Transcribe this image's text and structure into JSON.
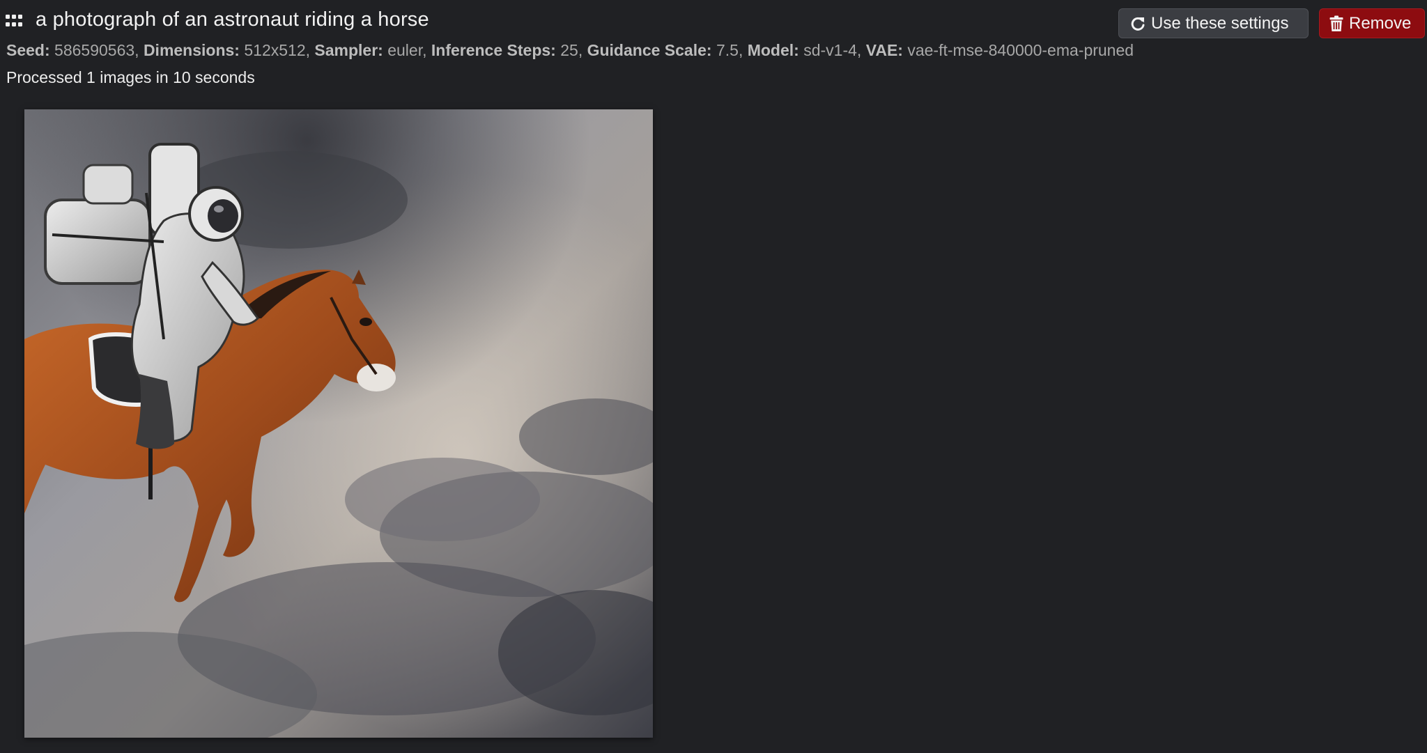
{
  "task": {
    "prompt": "a photograph of an astronaut riding a horse",
    "buttons": {
      "use_settings_label": "Use these settings",
      "remove_label": "Remove"
    },
    "settings": [
      {
        "label": "Seed:",
        "value": "586590563",
        "sep": ","
      },
      {
        "label": "Dimensions:",
        "value": "512x512",
        "sep": ","
      },
      {
        "label": "Sampler:",
        "value": "euler",
        "sep": ","
      },
      {
        "label": "Inference Steps:",
        "value": "25",
        "sep": ","
      },
      {
        "label": "Guidance Scale:",
        "value": "7.5",
        "sep": ","
      },
      {
        "label": "Model:",
        "value": "sd-v1-4",
        "sep": ","
      },
      {
        "label": "VAE:",
        "value": "vae-ft-mse-840000-ema-pruned",
        "sep": ""
      }
    ],
    "status": "Processed 1 images in 10 seconds",
    "image": {
      "alt": "a photograph of an astronaut riding a horse"
    }
  },
  "icons": {
    "drag": "grid-dots-icon",
    "use_settings": "redo-arrow-icon",
    "remove": "trash-icon"
  },
  "colors": {
    "background": "#202124",
    "remove_button": "#8d0c10",
    "use_button": "#3b3d42"
  }
}
